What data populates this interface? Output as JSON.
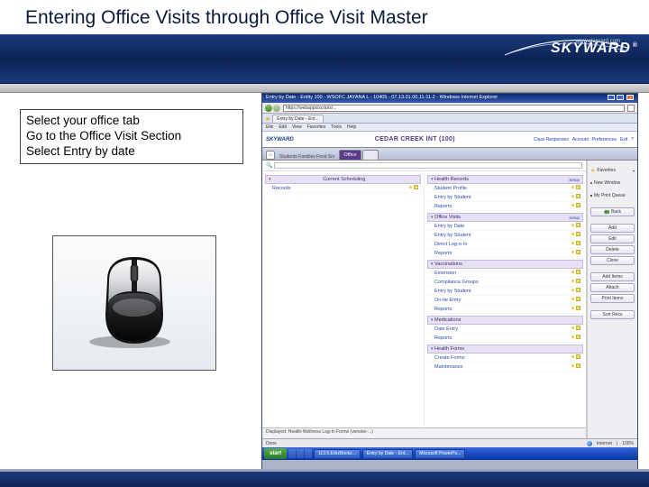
{
  "title": "Entering Office Visits through Office Visit Master",
  "logo": {
    "text": "SKYWARD",
    "url": "www.skyward.com",
    "reg": "®"
  },
  "instructions": [
    "Select your office tab",
    "Go to the Office Visit Section",
    "Select Entry by date"
  ],
  "app": {
    "window_title": "Entry by Date - Entity 100 - WSOFC JAYANA L - 10405 - 07.13.01.00.11-11.2 - Windows Internet Explorer",
    "address": "https://webapps/scripts/...",
    "tab": "Entry by Date - Ent...",
    "menubar": [
      "Eile",
      "Edit",
      "View",
      "Favorites",
      "Tools",
      "Help"
    ],
    "brand": "CEDAR CREEK INT (100)",
    "brand_links": [
      "Class Responses",
      "Account",
      "Preferences",
      "Exit",
      "?"
    ],
    "crumb": "Students  Families  Food Srv",
    "tabs": [
      {
        "label": "Office",
        "active": true
      }
    ],
    "search_placeholder": "",
    "left_sections": [
      {
        "header": "Current Scheduling",
        "items": [
          "Records"
        ]
      }
    ],
    "right_sections": [
      {
        "header": "Health Records",
        "setup": "Setup",
        "items": [
          "Student Profile",
          "Entry by Student",
          "Reports"
        ]
      },
      {
        "header": "Office Visits",
        "setup": "Setup",
        "items": [
          "Entry by Date",
          "Entry by Student",
          "Direct Log-o-In",
          "Reports"
        ]
      },
      {
        "header": "Vaccinations",
        "items": [
          "Extension",
          "Compliance Groups",
          "Entry by Student",
          "On-tie Entry",
          "Reports"
        ]
      },
      {
        "header": "Medications",
        "items": [
          "Date Entry",
          "Reports"
        ]
      },
      {
        "header": "Health Forms",
        "items": [
          "Create Forms",
          "Maintenance"
        ]
      }
    ],
    "right_panel": {
      "fav": "Favorites",
      "new_window": "New Window",
      "my_print": "My Print Queue",
      "spacer": true,
      "back": "Back",
      "buttons": [
        "Add",
        "Edit",
        "Delete",
        "Clone",
        "Add Items",
        "Attach",
        "Print Items",
        "Sort Recs"
      ]
    },
    "footer": "Displayed: Health-Wellness Log-In Forms (version-...)",
    "status": {
      "left": "Done",
      "zone": "Internet",
      "zoom": "100%"
    },
    "taskbar": {
      "start": "start",
      "items": [
        "113.5.ErbzBookz...",
        "Entry by Date - Ent...",
        "Microsoft PowerPo..."
      ],
      "tray": ""
    }
  }
}
